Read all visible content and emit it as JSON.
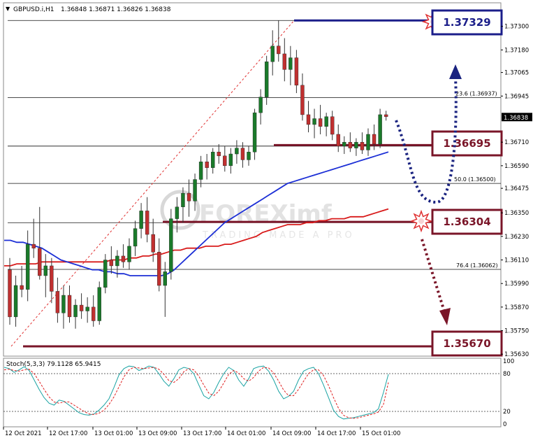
{
  "header": {
    "symbol": "GBPUSD.i,H1",
    "ohlc": "1.36848 1.36871 1.36826 1.36838"
  },
  "watermark": "FOREXimf",
  "watermark_sub": "TRADING MADE A PRO",
  "colors": {
    "bull": "#1a7a2a",
    "bear": "#c03030",
    "ma_fast": "#1c2fd6",
    "ma_slow": "#d81a1a",
    "level": "#7a1528",
    "box_blue": "#1b1e8a",
    "box_red": "#7a1528",
    "arrow_blue": "#1a2380",
    "arrow_red": "#7a1528",
    "stoch_main": "#1aa3a3",
    "stoch_signal": "#e02020"
  },
  "chart_data": {
    "type": "candlestick",
    "y_ticks": [
      "1.37300",
      "1.37180",
      "1.37065",
      "1.36945",
      "1.36838",
      "1.36710",
      "1.36590",
      "1.36475",
      "1.36350",
      "1.36230",
      "1.36110",
      "1.35990",
      "1.35870",
      "1.35750",
      "1.35630"
    ],
    "ylim": [
      1.3562,
      1.3742
    ],
    "x_ticks": [
      "12 Oct 2021",
      "12 Oct 17:00",
      "13 Oct 01:00",
      "13 Oct 09:00",
      "13 Oct 17:00",
      "14 Oct 01:00",
      "14 Oct 09:00",
      "14 Oct 17:00",
      "15 Oct 01:00"
    ],
    "current_price": "1.36838",
    "candles": [
      {
        "o": 1.3606,
        "h": 1.3612,
        "l": 1.3578,
        "c": 1.3582
      },
      {
        "o": 1.3582,
        "h": 1.3603,
        "l": 1.3577,
        "c": 1.3598
      },
      {
        "o": 1.3598,
        "h": 1.3608,
        "l": 1.3592,
        "c": 1.3596
      },
      {
        "o": 1.3596,
        "h": 1.3626,
        "l": 1.359,
        "c": 1.3619
      },
      {
        "o": 1.3619,
        "h": 1.3632,
        "l": 1.3612,
        "c": 1.3617
      },
      {
        "o": 1.3617,
        "h": 1.3638,
        "l": 1.3601,
        "c": 1.3603
      },
      {
        "o": 1.3603,
        "h": 1.3614,
        "l": 1.3592,
        "c": 1.3608
      },
      {
        "o": 1.3608,
        "h": 1.3612,
        "l": 1.3589,
        "c": 1.3595
      },
      {
        "o": 1.3595,
        "h": 1.3602,
        "l": 1.3579,
        "c": 1.3584
      },
      {
        "o": 1.3584,
        "h": 1.3598,
        "l": 1.3576,
        "c": 1.3593
      },
      {
        "o": 1.3593,
        "h": 1.3598,
        "l": 1.3579,
        "c": 1.3582
      },
      {
        "o": 1.3582,
        "h": 1.3591,
        "l": 1.3576,
        "c": 1.3588
      },
      {
        "o": 1.3588,
        "h": 1.3594,
        "l": 1.3581,
        "c": 1.3585
      },
      {
        "o": 1.3585,
        "h": 1.3592,
        "l": 1.3579,
        "c": 1.3587
      },
      {
        "o": 1.3587,
        "h": 1.3593,
        "l": 1.3577,
        "c": 1.358
      },
      {
        "o": 1.358,
        "h": 1.36,
        "l": 1.3578,
        "c": 1.3597
      },
      {
        "o": 1.3597,
        "h": 1.3614,
        "l": 1.3594,
        "c": 1.3611
      },
      {
        "o": 1.3611,
        "h": 1.3618,
        "l": 1.3604,
        "c": 1.3608
      },
      {
        "o": 1.3608,
        "h": 1.3616,
        "l": 1.3602,
        "c": 1.3613
      },
      {
        "o": 1.3613,
        "h": 1.3619,
        "l": 1.3607,
        "c": 1.361
      },
      {
        "o": 1.361,
        "h": 1.3622,
        "l": 1.3606,
        "c": 1.3618
      },
      {
        "o": 1.3618,
        "h": 1.3631,
        "l": 1.3613,
        "c": 1.3627
      },
      {
        "o": 1.3627,
        "h": 1.364,
        "l": 1.3622,
        "c": 1.3636
      },
      {
        "o": 1.3636,
        "h": 1.3643,
        "l": 1.362,
        "c": 1.3624
      },
      {
        "o": 1.3624,
        "h": 1.3632,
        "l": 1.361,
        "c": 1.3615
      },
      {
        "o": 1.3615,
        "h": 1.3622,
        "l": 1.3595,
        "c": 1.3598
      },
      {
        "o": 1.3598,
        "h": 1.361,
        "l": 1.3582,
        "c": 1.3605
      },
      {
        "o": 1.3605,
        "h": 1.3637,
        "l": 1.3601,
        "c": 1.3632
      },
      {
        "o": 1.3632,
        "h": 1.3643,
        "l": 1.3625,
        "c": 1.3638
      },
      {
        "o": 1.3638,
        "h": 1.3648,
        "l": 1.363,
        "c": 1.3645
      },
      {
        "o": 1.3645,
        "h": 1.3652,
        "l": 1.3633,
        "c": 1.3641
      },
      {
        "o": 1.3641,
        "h": 1.3655,
        "l": 1.3636,
        "c": 1.3652
      },
      {
        "o": 1.3652,
        "h": 1.3664,
        "l": 1.3648,
        "c": 1.3661
      },
      {
        "o": 1.3661,
        "h": 1.3665,
        "l": 1.3652,
        "c": 1.3658
      },
      {
        "o": 1.3658,
        "h": 1.3668,
        "l": 1.3655,
        "c": 1.3666
      },
      {
        "o": 1.3666,
        "h": 1.367,
        "l": 1.366,
        "c": 1.3664
      },
      {
        "o": 1.3664,
        "h": 1.3669,
        "l": 1.3656,
        "c": 1.3659
      },
      {
        "o": 1.3659,
        "h": 1.3668,
        "l": 1.3655,
        "c": 1.3665
      },
      {
        "o": 1.3665,
        "h": 1.3672,
        "l": 1.366,
        "c": 1.3668
      },
      {
        "o": 1.3668,
        "h": 1.3671,
        "l": 1.3658,
        "c": 1.3662
      },
      {
        "o": 1.3662,
        "h": 1.3669,
        "l": 1.3659,
        "c": 1.3666
      },
      {
        "o": 1.3666,
        "h": 1.3688,
        "l": 1.3662,
        "c": 1.3686
      },
      {
        "o": 1.3686,
        "h": 1.3698,
        "l": 1.368,
        "c": 1.3694
      },
      {
        "o": 1.3694,
        "h": 1.3715,
        "l": 1.369,
        "c": 1.3712
      },
      {
        "o": 1.3712,
        "h": 1.3728,
        "l": 1.3705,
        "c": 1.372
      },
      {
        "o": 1.372,
        "h": 1.3733,
        "l": 1.3712,
        "c": 1.3716
      },
      {
        "o": 1.3716,
        "h": 1.3724,
        "l": 1.3702,
        "c": 1.3708
      },
      {
        "o": 1.3708,
        "h": 1.372,
        "l": 1.37,
        "c": 1.3714
      },
      {
        "o": 1.3714,
        "h": 1.3718,
        "l": 1.3696,
        "c": 1.37
      },
      {
        "o": 1.37,
        "h": 1.3706,
        "l": 1.3682,
        "c": 1.3685
      },
      {
        "o": 1.3685,
        "h": 1.3692,
        "l": 1.3676,
        "c": 1.368
      },
      {
        "o": 1.368,
        "h": 1.3688,
        "l": 1.3673,
        "c": 1.3683
      },
      {
        "o": 1.3683,
        "h": 1.369,
        "l": 1.3675,
        "c": 1.3679
      },
      {
        "o": 1.3679,
        "h": 1.3686,
        "l": 1.3674,
        "c": 1.3684
      },
      {
        "o": 1.3684,
        "h": 1.3687,
        "l": 1.3672,
        "c": 1.3675
      },
      {
        "o": 1.3675,
        "h": 1.368,
        "l": 1.3666,
        "c": 1.3669
      },
      {
        "o": 1.3669,
        "h": 1.3674,
        "l": 1.3665,
        "c": 1.3671
      },
      {
        "o": 1.3671,
        "h": 1.3676,
        "l": 1.3666,
        "c": 1.3668
      },
      {
        "o": 1.3668,
        "h": 1.3673,
        "l": 1.3664,
        "c": 1.3671
      },
      {
        "o": 1.3671,
        "h": 1.3676,
        "l": 1.3665,
        "c": 1.3667
      },
      {
        "o": 1.3667,
        "h": 1.3678,
        "l": 1.3664,
        "c": 1.3675
      },
      {
        "o": 1.3675,
        "h": 1.368,
        "l": 1.3667,
        "c": 1.367
      },
      {
        "o": 1.367,
        "h": 1.3688,
        "l": 1.3668,
        "c": 1.3685
      },
      {
        "o": 1.3685,
        "h": 1.3687,
        "l": 1.3682,
        "c": 1.3684
      }
    ],
    "ma_fast": [
      1.3621,
      1.3621,
      1.362,
      1.362,
      1.3619,
      1.3618,
      1.3617,
      1.3615,
      1.3613,
      1.3611,
      1.361,
      1.3609,
      1.3608,
      1.3607,
      1.3606,
      1.3606,
      1.3605,
      1.3605,
      1.3604,
      1.3604,
      1.3603,
      1.3603,
      1.3603,
      1.3603,
      1.3603,
      1.3603,
      1.3604,
      1.3606,
      1.3609,
      1.3612,
      1.3615,
      1.3618,
      1.3621,
      1.3624,
      1.3627,
      1.363,
      1.3632,
      1.3634,
      1.3636,
      1.3638,
      1.364,
      1.3642,
      1.3644,
      1.3646,
      1.3648,
      1.365,
      1.3651,
      1.3652,
      1.3653,
      1.3654,
      1.3655,
      1.3656,
      1.3657,
      1.3658,
      1.3659,
      1.366,
      1.3661,
      1.3662,
      1.3663,
      1.3664,
      1.3665,
      1.3666
    ],
    "ma_slow": [
      1.3608,
      1.3608,
      1.3609,
      1.3609,
      1.3609,
      1.3609,
      1.361,
      1.361,
      1.361,
      1.361,
      1.361,
      1.361,
      1.361,
      1.361,
      1.361,
      1.361,
      1.361,
      1.3611,
      1.3611,
      1.3611,
      1.3612,
      1.3612,
      1.3613,
      1.3613,
      1.3614,
      1.3614,
      1.3615,
      1.3616,
      1.3616,
      1.3617,
      1.3617,
      1.3617,
      1.3618,
      1.3618,
      1.3618,
      1.3619,
      1.3619,
      1.362,
      1.3621,
      1.3622,
      1.3623,
      1.3625,
      1.3626,
      1.3627,
      1.3628,
      1.3629,
      1.3629,
      1.3629,
      1.363,
      1.363,
      1.3631,
      1.3631,
      1.3632,
      1.3632,
      1.3632,
      1.3633,
      1.3633,
      1.3633,
      1.3634,
      1.3635,
      1.3636,
      1.3637
    ],
    "fib_levels": [
      {
        "label": "23.6 (1.36937)"
      },
      {
        "label": "50.0 (1.36500)"
      },
      {
        "label": "76.4 (1.36062)"
      }
    ],
    "levels": [
      {
        "label": "1.37329",
        "style": "blue"
      },
      {
        "label": "1.36695",
        "style": "red"
      },
      {
        "label": "1.36304",
        "style": "red"
      },
      {
        "label": "1.35670",
        "style": "red"
      }
    ],
    "stochastic": {
      "label": "Stoch(5,3,3) 79.1128 65.9415",
      "y_ticks": [
        "100",
        "80",
        "20",
        "0"
      ],
      "main": [
        90,
        88,
        82,
        86,
        91,
        85,
        70,
        55,
        42,
        33,
        30,
        38,
        36,
        30,
        24,
        18,
        15,
        14,
        16,
        22,
        30,
        40,
        58,
        78,
        88,
        92,
        91,
        85,
        88,
        92,
        90,
        80,
        68,
        60,
        72,
        86,
        90,
        88,
        80,
        62,
        45,
        40,
        50,
        66,
        80,
        90,
        85,
        70,
        60,
        72,
        88,
        91,
        92,
        84,
        70,
        52,
        40,
        44,
        52,
        70,
        84,
        88,
        90,
        80,
        62,
        42,
        22,
        12,
        8,
        9,
        10,
        12,
        14,
        16,
        18,
        24,
        50,
        79
      ],
      "signal": [
        86,
        87,
        85,
        84,
        86,
        87,
        80,
        68,
        55,
        43,
        35,
        33,
        35,
        35,
        30,
        25,
        20,
        16,
        15,
        17,
        22,
        31,
        43,
        59,
        75,
        86,
        90,
        89,
        88,
        89,
        90,
        87,
        79,
        69,
        66,
        72,
        83,
        88,
        86,
        76,
        62,
        49,
        45,
        52,
        65,
        79,
        85,
        81,
        72,
        68,
        74,
        84,
        90,
        89,
        81,
        68,
        54,
        45,
        45,
        55,
        68,
        80,
        86,
        86,
        77,
        61,
        42,
        25,
        14,
        10,
        9,
        10,
        12,
        14,
        16,
        19,
        31,
        66
      ]
    }
  }
}
